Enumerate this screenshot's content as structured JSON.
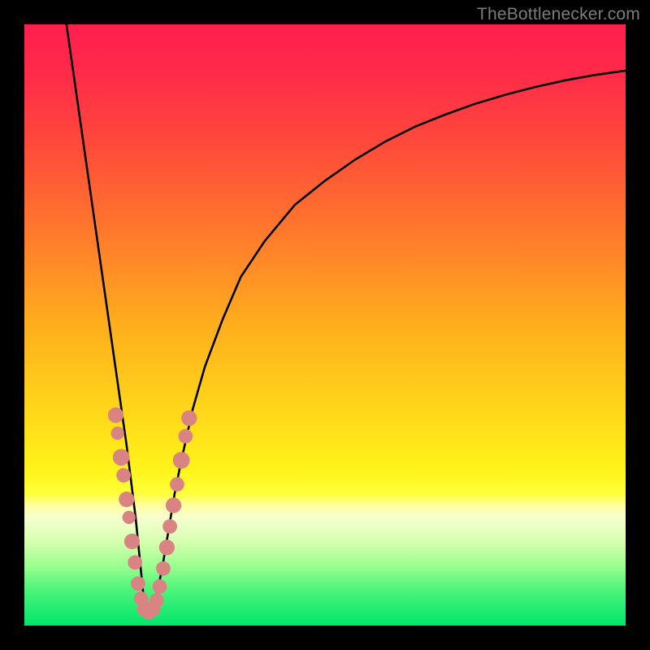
{
  "attribution": "TheBottlenecker.com",
  "colors": {
    "frame": "#000000",
    "attribution_text": "#7c7c7c",
    "curve_stroke": "#000000",
    "marker_fill": "#d98383",
    "gradient_stops": [
      {
        "offset": 0.0,
        "color": "#ff1f4e"
      },
      {
        "offset": 0.08,
        "color": "#ff2a4a"
      },
      {
        "offset": 0.2,
        "color": "#ff4a3a"
      },
      {
        "offset": 0.35,
        "color": "#ff7a2c"
      },
      {
        "offset": 0.5,
        "color": "#ffae1c"
      },
      {
        "offset": 0.65,
        "color": "#ffd91a"
      },
      {
        "offset": 0.74,
        "color": "#fff31a"
      },
      {
        "offset": 0.78,
        "color": "#ffff3a"
      },
      {
        "offset": 0.8,
        "color": "#ffffa0"
      },
      {
        "offset": 0.82,
        "color": "#f7ffd0"
      },
      {
        "offset": 0.86,
        "color": "#d6ffb0"
      },
      {
        "offset": 0.9,
        "color": "#9cff90"
      },
      {
        "offset": 0.94,
        "color": "#4cf57a"
      },
      {
        "offset": 1.0,
        "color": "#00e56a"
      }
    ]
  },
  "chart_data": {
    "type": "line",
    "title": "",
    "xlabel": "",
    "ylabel": "",
    "xlim": [
      0,
      100
    ],
    "ylim": [
      0,
      100
    ],
    "note": "x and y are in percent of plot width/height; y=0 is bottom (green), y=100 is top (red). Curve is a V-shaped bottleneck profile with minimum near x≈20.",
    "series": [
      {
        "name": "bottleneck-curve",
        "x": [
          7,
          8,
          9,
          10,
          11,
          12,
          13,
          14,
          15,
          16,
          17,
          18,
          18.5,
          19,
          19.5,
          20,
          20.5,
          21,
          21.5,
          22,
          23,
          24,
          25,
          26,
          28,
          30,
          33,
          36,
          40,
          45,
          50,
          55,
          60,
          65,
          70,
          75,
          80,
          85,
          90,
          95,
          100
        ],
        "y": [
          100,
          93,
          86,
          79,
          72,
          65,
          58,
          51,
          44,
          37,
          30,
          22,
          18,
          13,
          8,
          3,
          2,
          2,
          3,
          5,
          10,
          16,
          22,
          27,
          36,
          43,
          51,
          58,
          64,
          70,
          74,
          77.5,
          80.5,
          83,
          85,
          86.8,
          88.3,
          89.6,
          90.7,
          91.6,
          92.3
        ]
      }
    ],
    "markers": {
      "name": "sample-points",
      "note": "Pink circular markers clustered around the valley of the curve.",
      "points": [
        {
          "x": 15.2,
          "y": 35.0,
          "r": 1.3
        },
        {
          "x": 15.5,
          "y": 32.0,
          "r": 1.1
        },
        {
          "x": 16.1,
          "y": 28.0,
          "r": 1.4
        },
        {
          "x": 16.5,
          "y": 25.0,
          "r": 1.2
        },
        {
          "x": 17.0,
          "y": 21.0,
          "r": 1.3
        },
        {
          "x": 17.4,
          "y": 18.0,
          "r": 1.1
        },
        {
          "x": 17.9,
          "y": 14.0,
          "r": 1.3
        },
        {
          "x": 18.4,
          "y": 10.5,
          "r": 1.2
        },
        {
          "x": 18.9,
          "y": 7.0,
          "r": 1.2
        },
        {
          "x": 19.4,
          "y": 4.5,
          "r": 1.2
        },
        {
          "x": 20.0,
          "y": 2.8,
          "r": 1.3
        },
        {
          "x": 20.7,
          "y": 2.2,
          "r": 1.2
        },
        {
          "x": 21.4,
          "y": 2.7,
          "r": 1.2
        },
        {
          "x": 22.0,
          "y": 4.2,
          "r": 1.2
        },
        {
          "x": 22.5,
          "y": 6.5,
          "r": 1.2
        },
        {
          "x": 23.1,
          "y": 9.5,
          "r": 1.2
        },
        {
          "x": 23.7,
          "y": 13.0,
          "r": 1.3
        },
        {
          "x": 24.2,
          "y": 16.5,
          "r": 1.2
        },
        {
          "x": 24.8,
          "y": 20.0,
          "r": 1.3
        },
        {
          "x": 25.4,
          "y": 23.5,
          "r": 1.2
        },
        {
          "x": 26.1,
          "y": 27.5,
          "r": 1.4
        },
        {
          "x": 26.8,
          "y": 31.5,
          "r": 1.2
        },
        {
          "x": 27.4,
          "y": 34.5,
          "r": 1.3
        }
      ]
    }
  }
}
